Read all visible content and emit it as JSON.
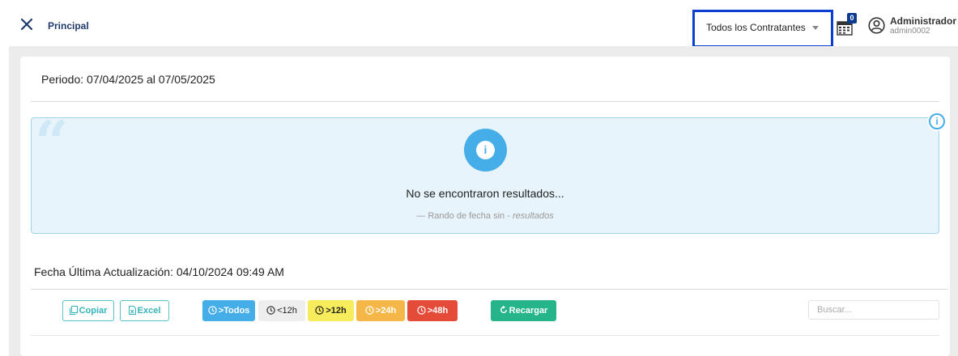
{
  "header": {
    "nav_title": "Principal",
    "close_icon": "close-icon",
    "contract_select": {
      "selected": "Todos los Contratantes",
      "icon": "caret-down-icon"
    },
    "calendar_badge": "0",
    "user": {
      "name": "Administrador",
      "id": "admin0002",
      "icon": "user-circle-icon"
    }
  },
  "periodo": "Periodo: 07/04/2025 al 07/05/2025",
  "alert": {
    "title": "No se encontraron resultados...",
    "subtitle_prefix": "— Rando de fecha sin -",
    "subtitle_italic": "resultados",
    "icon": "info-icon"
  },
  "fecha_actualizacion": "Fecha Última Actualización: 04/10/2024 09:49 AM",
  "toolbar": {
    "copiar": "Copiar",
    "excel": "Excel",
    "todos": ">Todos",
    "lt12": "<12h",
    "gt12": ">12h",
    "gt24": ">24h",
    "gt48": ">48h",
    "recargar": "Recargar"
  },
  "search": {
    "placeholder": "Buscar..."
  },
  "colors": {
    "accent": "#45aee8",
    "select_border": "#0a3fd1",
    "nav_title": "#1f3a6b",
    "outline_teal": "#35b4b9",
    "yellow": "#f7ec5b",
    "orange": "#f6b749",
    "red": "#e54b39",
    "green": "#26b48a"
  }
}
